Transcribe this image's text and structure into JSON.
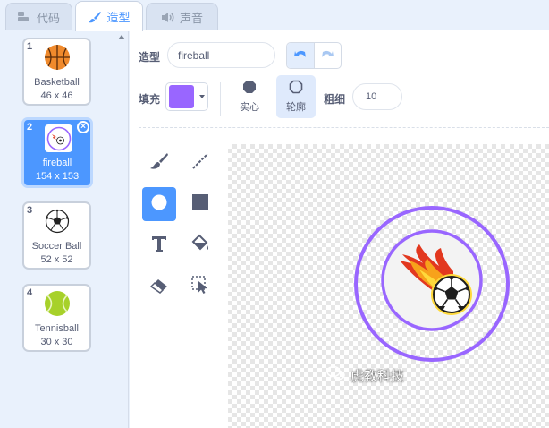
{
  "tabs": [
    {
      "label": "代码",
      "icon": "code-icon",
      "active": false
    },
    {
      "label": "造型",
      "icon": "brush-icon",
      "active": true
    },
    {
      "label": "声音",
      "icon": "speaker-icon",
      "active": false
    }
  ],
  "costumes": [
    {
      "index": "1",
      "name": "Basketball",
      "size": "46 x 46",
      "thumb": "basketball-icon",
      "selected": false
    },
    {
      "index": "2",
      "name": "fireball",
      "size": "154 x 153",
      "thumb": "fireball-icon",
      "selected": true
    },
    {
      "index": "3",
      "name": "Soccer Ball",
      "size": "52 x 52",
      "thumb": "soccer-ball-icon",
      "selected": false
    },
    {
      "index": "4",
      "name": "Tennisball",
      "size": "30 x 30",
      "thumb": "tennis-ball-icon",
      "selected": false
    }
  ],
  "editor": {
    "costume_label": "造型",
    "costume_name": "fireball",
    "fill_label": "填充",
    "fill_color": "#9966ff",
    "solid_label": "实心",
    "outline_label": "轮廓",
    "thickness_label": "粗细",
    "thickness_value": "10",
    "accent_color": "#4c97ff"
  },
  "tools": [
    {
      "name": "brush-tool-icon",
      "active": false
    },
    {
      "name": "line-tool-icon",
      "active": false
    },
    {
      "name": "circle-tool-icon",
      "active": true
    },
    {
      "name": "rectangle-tool-icon",
      "active": false
    },
    {
      "name": "text-tool-icon",
      "active": false
    },
    {
      "name": "fill-tool-icon",
      "active": false
    },
    {
      "name": "eraser-tool-icon",
      "active": false
    },
    {
      "name": "select-tool-icon",
      "active": false
    }
  ],
  "watermark": {
    "text": "虎教科技",
    "icon": "wechat-icon"
  }
}
